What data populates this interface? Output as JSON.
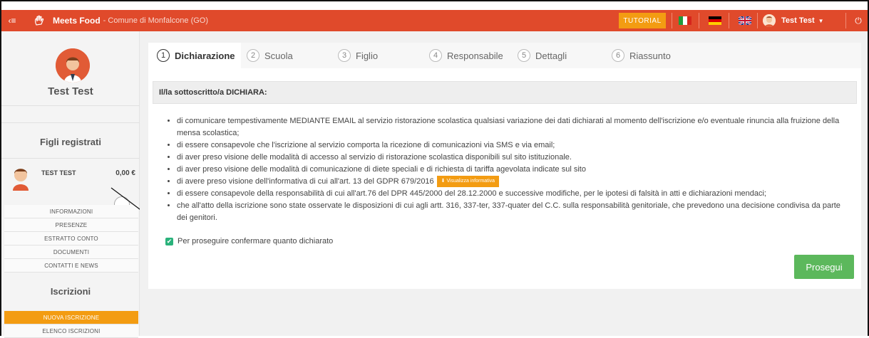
{
  "header": {
    "brand": "Meets Food",
    "location": "- Comune di Monfalcone (GO)",
    "tutorial_label": "TUTORIAL",
    "user_name": "Test Test",
    "colors": {
      "bar": "#e04a2b",
      "tutorial": "#f39c12"
    }
  },
  "sidebar": {
    "user_name": "Test Test",
    "children_title": "Figli registrati",
    "child": {
      "name": "TEST TEST",
      "balance": "0,00 €"
    },
    "links": [
      "INFORMAZIONI",
      "PRESENZE",
      "ESTRATTO CONTO",
      "DOCUMENTI",
      "CONTATTI E NEWS"
    ],
    "enroll_title": "Iscrizioni",
    "enroll_links": [
      "NUOVA ISCRIZIONE",
      "ELENCO ISCRIZIONI"
    ]
  },
  "wizard": {
    "steps": [
      {
        "num": "1",
        "label": "Dichiarazione"
      },
      {
        "num": "2",
        "label": "Scuola"
      },
      {
        "num": "3",
        "label": "Figlio"
      },
      {
        "num": "4",
        "label": "Responsabile"
      },
      {
        "num": "5",
        "label": "Dettagli"
      },
      {
        "num": "6",
        "label": "Riassunto"
      }
    ],
    "active_step": 1
  },
  "declaration": {
    "header": "Il/la sottoscritto/a DICHIARA:",
    "items": [
      "di comunicare tempestivamente MEDIANTE EMAIL al servizio ristorazione scolastica qualsiasi variazione dei dati dichiarati al momento dell'iscrizione e/o eventuale rinuncia alla fruizione della mensa scolastica;",
      "di essere consapevole che l'iscrizione al servizio comporta la ricezione di comunicazioni via SMS e via email;",
      "di aver preso visione delle modalità di accesso al servizio di ristorazione scolastica disponibili sul sito istituzionale.",
      "di aver preso visione delle modalità di comunicazione di diete speciali e di richiesta di tariffa agevolata indicate sul sito",
      "di avere preso visione dell'informativa di cui all'art. 13 del GDPR 679/2016",
      "di essere consapevole della responsabilità di cui all'art.76 del DPR 445/2000 del 28.12.2000 e successive modifiche, per le ipotesi di falsità in atti e dichiarazioni mendaci;",
      "che all'atto della iscrizione sono state osservate le disposizioni di cui agli artt. 316, 337-ter, 337-quater del C.C. sulla responsabilità genitoriale, che prevedono una decisione condivisa da parte dei genitori."
    ],
    "info_button": "Visualizza informativa",
    "confirm_label": "Per proseguire confermare quanto dichiarato",
    "confirm_checked": true,
    "proceed_label": "Prosegui"
  }
}
